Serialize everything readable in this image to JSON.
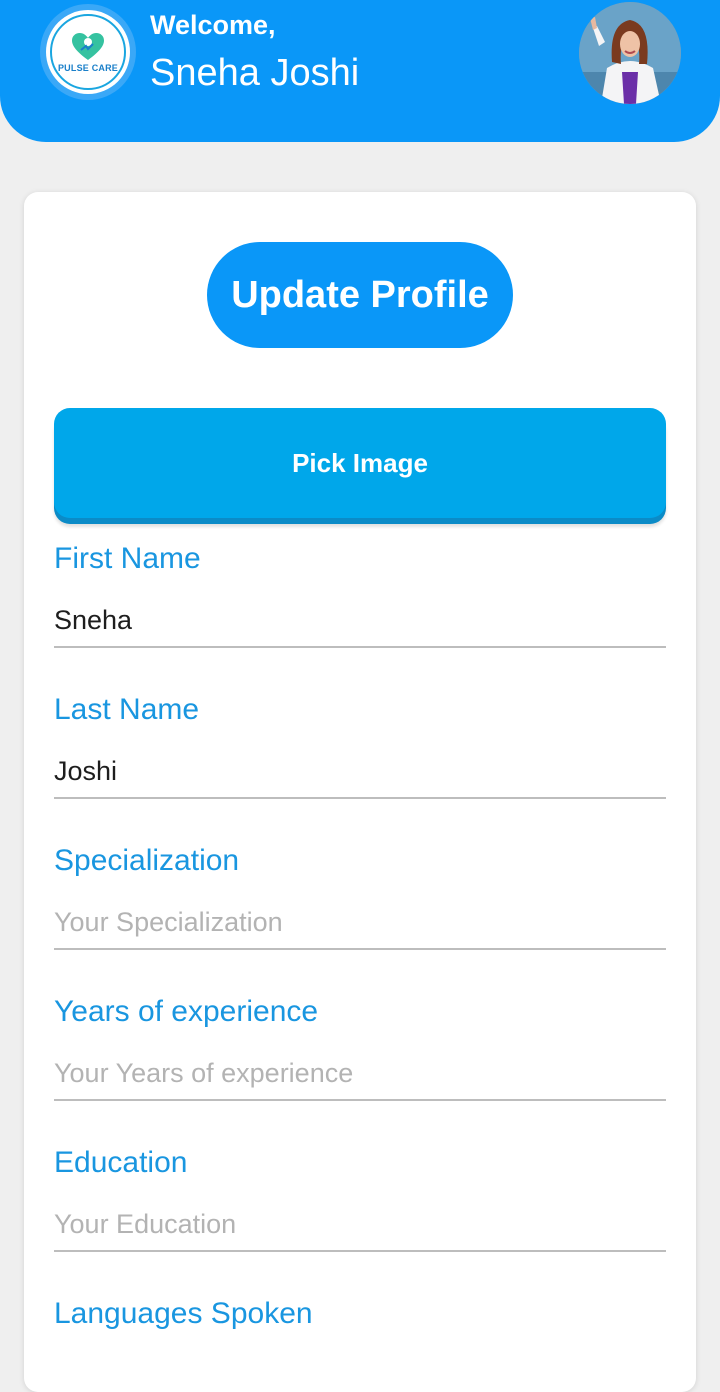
{
  "header": {
    "logo_text": "PULSE CARE",
    "welcome": "Welcome,",
    "user_name": "Sneha Joshi",
    "bg_color": "#0a97f8"
  },
  "profile": {
    "update_button": "Update Profile",
    "pick_image_button": "Pick Image"
  },
  "fields": [
    {
      "label": "First Name",
      "value": "Sneha",
      "placeholder": ""
    },
    {
      "label": "Last Name",
      "value": "Joshi",
      "placeholder": ""
    },
    {
      "label": "Specialization",
      "value": "",
      "placeholder": "Your Specialization"
    },
    {
      "label": "Years of experience",
      "value": "",
      "placeholder": "Your Years of experience"
    },
    {
      "label": "Education",
      "value": "",
      "placeholder": "Your Education"
    },
    {
      "label": "Languages Spoken",
      "value": "",
      "placeholder": ""
    }
  ],
  "colors": {
    "primary": "#0a97f8",
    "pick_button": "#00a7ea",
    "label": "#1996e0",
    "placeholder": "#b3b3b3"
  }
}
